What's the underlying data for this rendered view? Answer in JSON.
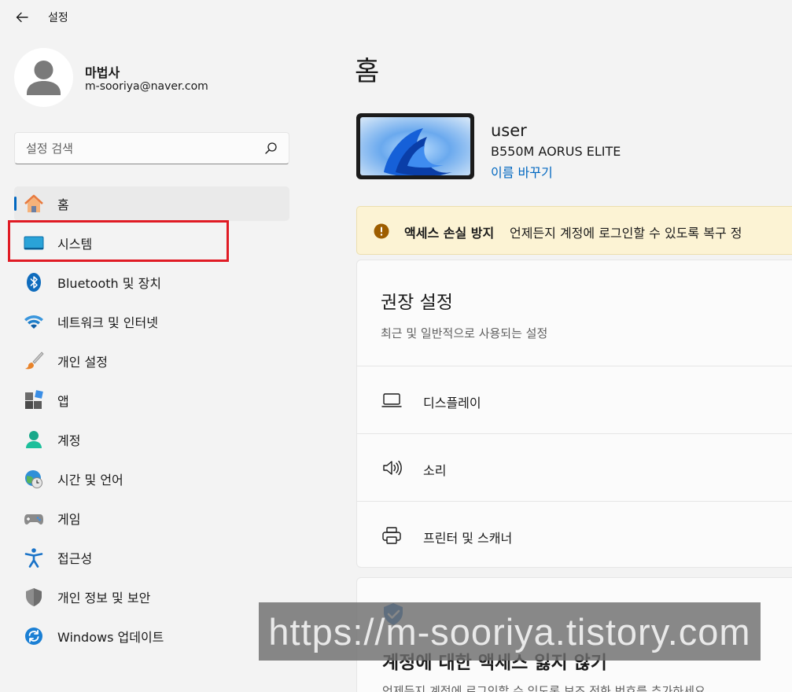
{
  "app": {
    "title": "설정"
  },
  "profile": {
    "name": "마법사",
    "email": "m-sooriya@naver.com"
  },
  "search": {
    "placeholder": "설정 검색"
  },
  "sidebar": {
    "items": [
      {
        "label": "홈",
        "icon": "home-icon",
        "active": true
      },
      {
        "label": "시스템",
        "icon": "system-icon",
        "active": false
      },
      {
        "label": "Bluetooth 및 장치",
        "icon": "bluetooth-icon",
        "active": false
      },
      {
        "label": "네트워크 및 인터넷",
        "icon": "wifi-icon",
        "active": false
      },
      {
        "label": "개인 설정",
        "icon": "brush-icon",
        "active": false
      },
      {
        "label": "앱",
        "icon": "apps-icon",
        "active": false
      },
      {
        "label": "계정",
        "icon": "account-icon",
        "active": false
      },
      {
        "label": "시간 및 언어",
        "icon": "globe-clock-icon",
        "active": false
      },
      {
        "label": "게임",
        "icon": "gamepad-icon",
        "active": false
      },
      {
        "label": "접근성",
        "icon": "accessibility-icon",
        "active": false
      },
      {
        "label": "개인 정보 및 보안",
        "icon": "shield-icon",
        "active": false
      },
      {
        "label": "Windows 업데이트",
        "icon": "update-icon",
        "active": false
      }
    ]
  },
  "main": {
    "title": "홈",
    "device": {
      "name": "user",
      "model": "B550M AORUS ELITE",
      "rename_label": "이름 바꾸기"
    },
    "banner": {
      "title": "액세스 손실 방지",
      "text": "언제든지 계정에 로그인할 수 있도록 복구 정"
    },
    "recommended": {
      "title": "권장 설정",
      "subtitle": "최근 및 일반적으로 사용되는 설정",
      "items": [
        {
          "label": "디스플레이",
          "icon": "display-icon"
        },
        {
          "label": "소리",
          "icon": "speaker-icon"
        },
        {
          "label": "프린터 및 스캐너",
          "icon": "printer-icon"
        }
      ]
    },
    "account_card": {
      "title": "계정에 대한 액세스 잃지 않기",
      "description": "언제든지 계정에 로그인할 수 있도록 보조 전화 번호를 추가하세요"
    }
  },
  "watermark": {
    "text": "https://m-sooriya.tistory.com"
  },
  "colors": {
    "accent": "#0067c0",
    "highlight": "#e01b24",
    "banner_bg": "#fcf3d4",
    "warning": "#9d5d00"
  }
}
